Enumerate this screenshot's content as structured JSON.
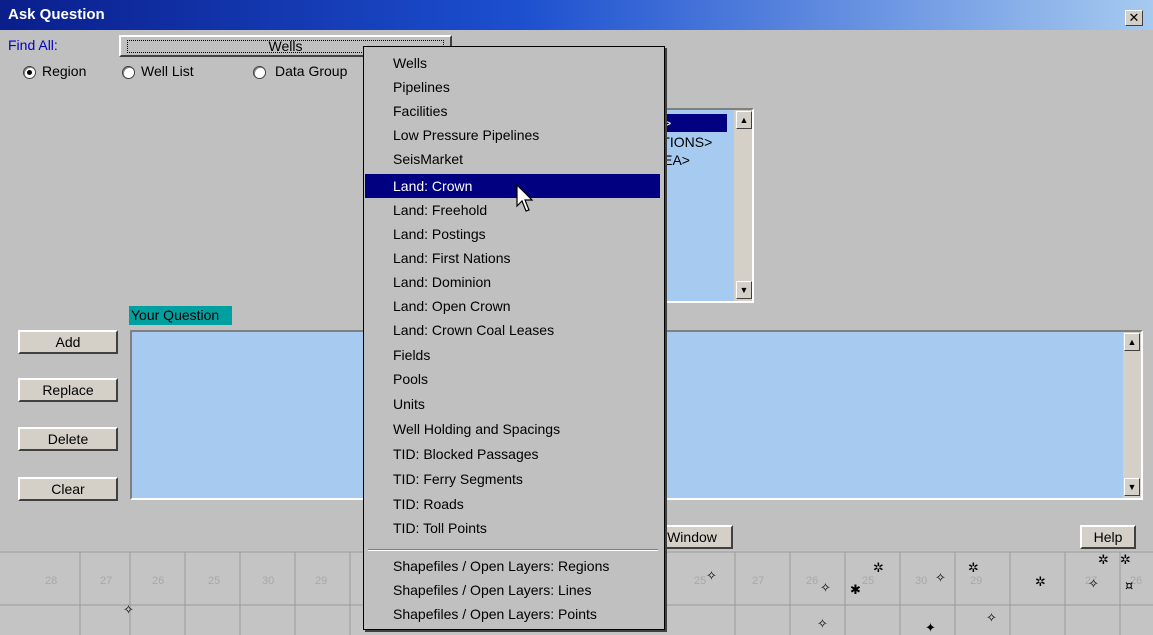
{
  "window": {
    "title": "Ask Question",
    "close_symbol": "✕"
  },
  "find_all": {
    "label": "Find All:",
    "selected": "Wells"
  },
  "radios": [
    {
      "label": "Region",
      "checked": true
    },
    {
      "label": "Well List",
      "checked": false
    },
    {
      "label": "Data Group",
      "checked": false
    }
  ],
  "list": {
    "items": [
      "N>",
      "ATIONS>",
      "REA>"
    ],
    "selected_index": 0
  },
  "question": {
    "label": "Your Question",
    "text": ""
  },
  "buttons": {
    "add": "Add",
    "replace": "Replace",
    "delete": "Delete",
    "clear": "Clear",
    "window": "Window",
    "help": "Help"
  },
  "dropdown": {
    "options": [
      "Wells",
      "Pipelines",
      "Facilities",
      "Low Pressure Pipelines",
      "SeisMarket",
      "Land: Crown",
      "Land: Freehold",
      "Land: Postings",
      "Land: First Nations",
      "Land: Dominion",
      "Land: Open Crown",
      "Land: Crown Coal Leases",
      "Fields",
      "Pools",
      "Units",
      "Well Holding and Spacings",
      "TID: Blocked Passages",
      "TID: Ferry Segments",
      "TID: Roads",
      "TID: Toll Points"
    ],
    "options2": [
      "Shapefiles / Open Layers: Regions",
      "Shapefiles / Open Layers: Lines",
      "Shapefiles / Open Layers: Points"
    ],
    "highlighted": "Land: Crown"
  },
  "map": {
    "sections": [
      "28",
      "27",
      "26",
      "25",
      "30",
      "29",
      "25",
      "27",
      "26",
      "25",
      "30",
      "29",
      "27",
      "26"
    ],
    "line_color": "#9a9a9a",
    "label_color": "#a8a8a8"
  },
  "colors": {
    "title_start": "#0a1e8c",
    "title_end": "#a6caf0",
    "selection": "#000080",
    "field_bg": "#a6caf0",
    "label_bg": "#00a0a0"
  }
}
